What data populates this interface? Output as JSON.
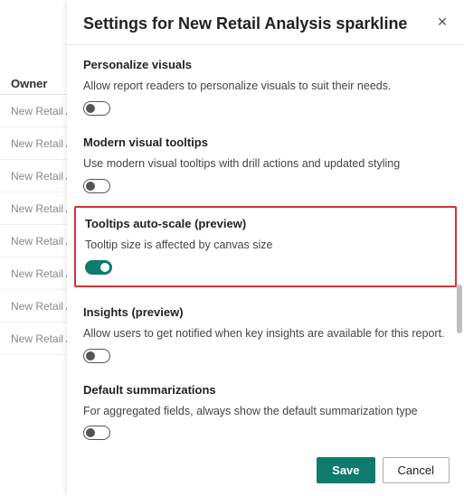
{
  "bg": {
    "owner_header": "Owner",
    "row_label": "New Retail Ana"
  },
  "panel": {
    "title": "Settings for New Retail Analysis sparkline",
    "close_icon": "✕",
    "footer": {
      "save": "Save",
      "cancel": "Cancel"
    }
  },
  "sections": {
    "personalize": {
      "title": "Personalize visuals",
      "desc": "Allow report readers to personalize visuals to suit their needs.",
      "on": false
    },
    "modern_tooltips": {
      "title": "Modern visual tooltips",
      "desc": "Use modern visual tooltips with drill actions and updated styling",
      "on": false
    },
    "tooltips_autoscale": {
      "title": "Tooltips auto-scale (preview)",
      "desc": "Tooltip size is affected by canvas size",
      "on": true
    },
    "insights": {
      "title": "Insights (preview)",
      "desc": "Allow users to get notified when key insights are available for this report.",
      "on": false
    },
    "default_summarizations": {
      "title": "Default summarizations",
      "desc": "For aggregated fields, always show the default summarization type",
      "on": false
    }
  }
}
